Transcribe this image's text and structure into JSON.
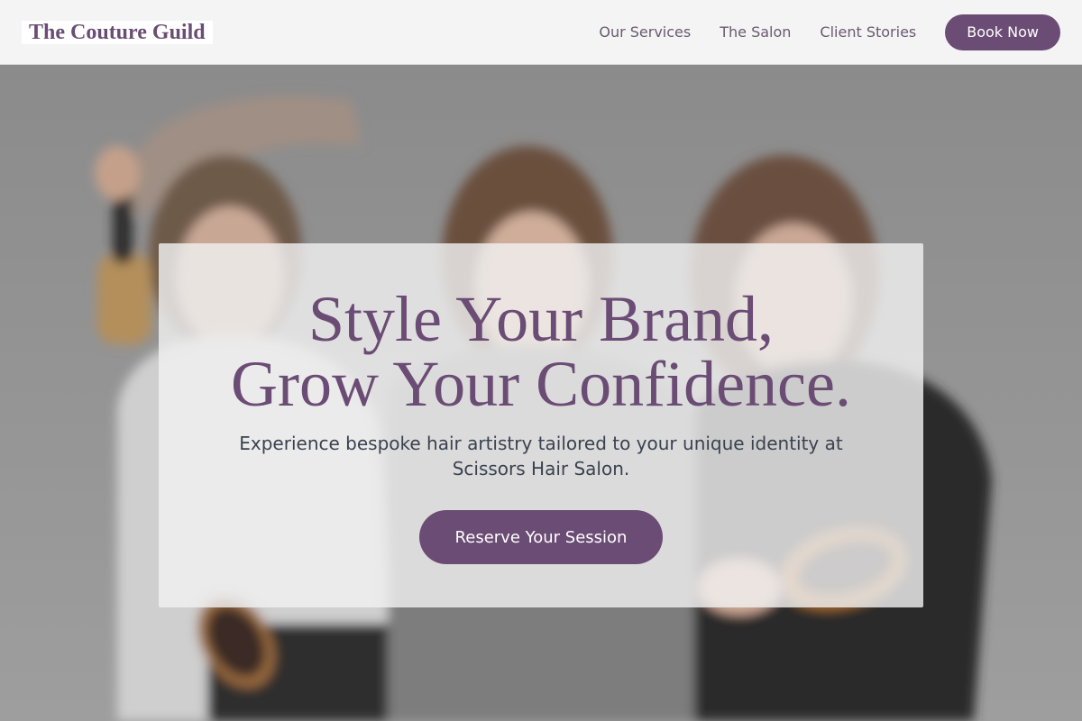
{
  "brand": {
    "name": "The Couture Guild"
  },
  "nav": {
    "links": [
      {
        "label": "Our Services"
      },
      {
        "label": "The Salon"
      },
      {
        "label": "Client Stories"
      }
    ],
    "cta_label": "Book Now"
  },
  "hero": {
    "headline_line1": "Style Your Brand,",
    "headline_line2": "Grow Your Confidence.",
    "subtext": "Experience bespoke hair artistry tailored to your unique identity at Scissors Hair Salon.",
    "cta_label": "Reserve Your Session",
    "image": "three-stylists-holding-hairbrushes-photo"
  },
  "colors": {
    "accent": "#6b4c74",
    "nav_bg": "#f4f4f4",
    "body_text": "#3a4250"
  }
}
